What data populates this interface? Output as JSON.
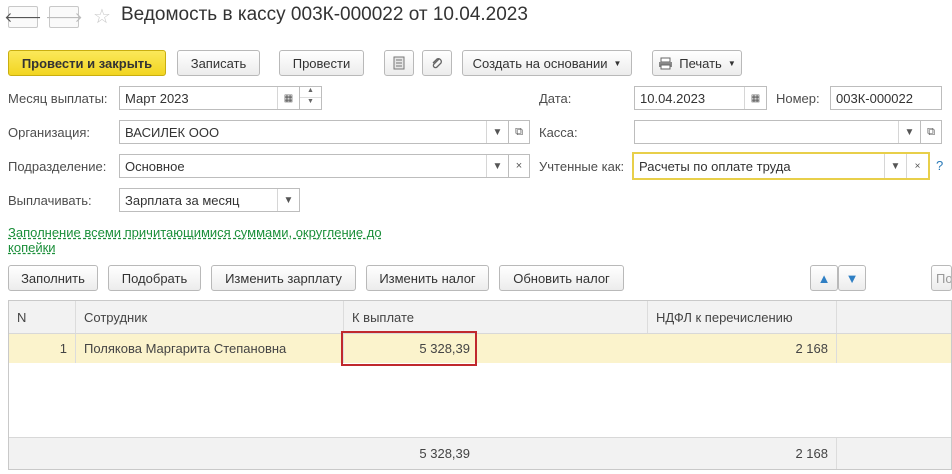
{
  "window": {
    "title": "Ведомость в кассу 003К-000022 от 10.04.2023"
  },
  "toolbar": {
    "post_close": "Провести и закрыть",
    "save": "Записать",
    "post": "Провести",
    "create_based": "Создать на основании",
    "print": "Печать"
  },
  "form": {
    "month_label": "Месяц выплаты:",
    "month_value": "Март 2023",
    "date_label": "Дата:",
    "date_value": "10.04.2023",
    "number_label": "Номер:",
    "number_value": "003К-000022",
    "org_label": "Организация:",
    "org_value": "ВАСИЛЕК ООО",
    "kassa_label": "Касса:",
    "kassa_value": "",
    "dept_label": "Подразделение:",
    "dept_value": "Основное",
    "accounted_label": "Учтенные как:",
    "accounted_value": "Расчеты по оплате труда",
    "help": "?",
    "pay_label": "Выплачивать:",
    "pay_value": "Зарплата за месяц",
    "fill_link": "Заполнение всеми причитающимися суммами, округление до копейки"
  },
  "actions": {
    "fill": "Заполнить",
    "select": "Подобрать",
    "change_salary": "Изменить зарплату",
    "change_tax": "Изменить налог",
    "update_tax": "Обновить налог",
    "more": "По"
  },
  "table": {
    "headers": {
      "n": "N",
      "employee": "Сотрудник",
      "to_pay": "К выплате",
      "ndfl": "НДФЛ к перечислению"
    },
    "rows": [
      {
        "n": "1",
        "employee": "Полякова Маргарита Степановна",
        "to_pay": "5 328,39",
        "ndfl": "2 168"
      }
    ],
    "totals": {
      "to_pay": "5 328,39",
      "ndfl": "2 168"
    }
  },
  "colors": {
    "primary_button": "#f2d521",
    "link": "#1b8f3a",
    "highlight_box": "#c0282d",
    "selected_row": "#fbf3cc",
    "active_field_border": "#e8cf4a"
  }
}
